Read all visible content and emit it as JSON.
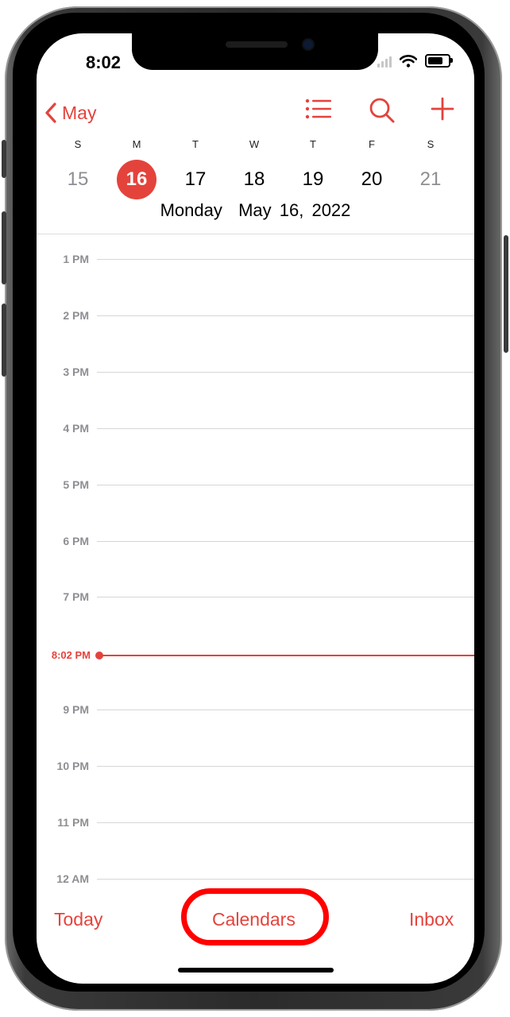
{
  "status_bar": {
    "time": "8:02"
  },
  "nav": {
    "back_label": "May",
    "icons": [
      "list-icon",
      "search-icon",
      "add-icon"
    ]
  },
  "week": {
    "weekdays": [
      "S",
      "M",
      "T",
      "W",
      "T",
      "F",
      "S"
    ],
    "dates": [
      "15",
      "16",
      "17",
      "18",
      "19",
      "20",
      "21"
    ],
    "selected_index": 1,
    "selected_label": "Monday  May 16, 2022"
  },
  "timeline": {
    "hours": [
      "1 PM",
      "2 PM",
      "3 PM",
      "4 PM",
      "5 PM",
      "6 PM",
      "7 PM",
      "9 PM",
      "10 PM",
      "11 PM",
      "12 AM"
    ],
    "now_label": "8:02 PM"
  },
  "toolbar": {
    "today_label": "Today",
    "calendars_label": "Calendars",
    "inbox_label": "Inbox"
  },
  "colors": {
    "accent": "#e4433c",
    "annotation": "#ff0000",
    "weekend_date": "#8e8e93",
    "weekday_date": "#000000"
  }
}
